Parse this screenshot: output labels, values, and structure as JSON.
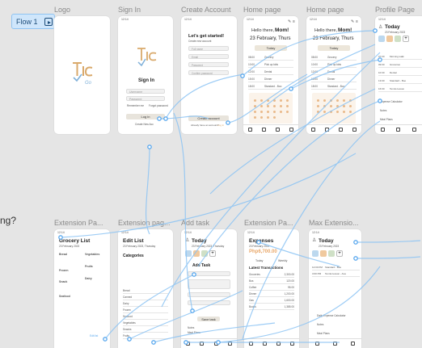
{
  "flow": {
    "label": "Flow 1"
  },
  "side_text": "ng?",
  "frames": {
    "logo": {
      "title": "Logo",
      "brand": "Tic Task",
      "brand_sub": "Go"
    },
    "signin": {
      "title": "Sign In",
      "time": "12:14",
      "heading": "Sign In",
      "brand": "Tic Task",
      "brand_sub": "Go",
      "username_ph": "Username",
      "password_ph": "Password",
      "remember": "Remember me",
      "forgot": "Forgot password",
      "login": "Log in",
      "signup": "Create New Acc"
    },
    "create": {
      "title": "Create Account",
      "time": "12:14",
      "heading": "Let's get started!",
      "sub": "Create new account",
      "field1": "Full name",
      "field2": "Email",
      "field3": "Password",
      "field4": "Confirm password",
      "button": "Create account",
      "footer": "Already have an account?",
      "footer_link": "Log in"
    },
    "home1": {
      "title": "Home page",
      "time": "12:14",
      "greet": "Hello there,",
      "name": "Mom!",
      "date": "23 February, Thurs",
      "today": "Today",
      "rows": [
        "Grocery",
        "Pick up kids",
        "Dental",
        "Dinner",
        "Standard - Boo"
      ],
      "times": [
        "08:00",
        "10:00",
        "12:00",
        "15:00",
        "18:00"
      ]
    },
    "home2": {
      "title": "Home page",
      "time": "12:14",
      "greet": "Hello there,",
      "name": "Mom!",
      "date": "23 February, Thurs",
      "today": "Today",
      "rows": [
        "Grocery",
        "Pick up kids",
        "Dental",
        "Dinner",
        "Standard - Boo"
      ],
      "times": [
        "08:00",
        "10:00",
        "12:00",
        "15:00",
        "18:00"
      ]
    },
    "profile": {
      "title": "Profile Page",
      "time": "12:14",
      "heading": "Today",
      "date": "23 February 2023",
      "rows": [
        "Morning walk",
        "Groceries",
        "Dental",
        "Standard - Boo",
        "Tennis lesson"
      ],
      "times": [
        "07:00",
        "09:00",
        "10:30",
        "13:00",
        "16:00"
      ],
      "links": [
        "Expense Calculator",
        "Notes",
        "Meal Plans"
      ]
    },
    "ext1": {
      "title": "Extension Pa...",
      "time": "12:14",
      "heading": "Grocery List",
      "date": "23 February 2023",
      "sections": [
        "Bread",
        "Frozen",
        "Snack",
        "Seafood"
      ],
      "sections2": [
        "Vegetables",
        "Fruits",
        "Dairy"
      ],
      "done": "Edit list"
    },
    "ext2": {
      "title": "Extension pag...",
      "time": "12:14",
      "heading": "Edit List",
      "date": "23 February 2023, Thursday",
      "categories": "Categories",
      "items": [
        "Bread",
        "Canned",
        "Dairy",
        "Frozen",
        "Seafood",
        "Vegetables",
        "Snacks",
        "Fruits"
      ]
    },
    "addtask": {
      "title": "Add task",
      "time": "12:14",
      "heading": "Today",
      "date": "23 February 2023, Thursday",
      "sub": "Add Task",
      "save": "Save task",
      "links": [
        "Notes",
        "Meal Plans"
      ]
    },
    "ext3": {
      "title": "Extension Pa...",
      "time": "12:14",
      "heading": "Expenses",
      "date": "23 February 2023",
      "amount": "Php6,700.00",
      "tabs": [
        "Today",
        "Weekly"
      ],
      "latest": "Latest Transactions",
      "rows": [
        "Groceries",
        "Bus",
        "Coffee",
        "Dinner",
        "Gas",
        "Books"
      ],
      "values": [
        "2,300.00",
        "120.00",
        "95.00",
        "1,200.00",
        "1,600.00",
        "1,385.00"
      ]
    },
    "maxext": {
      "title": "Max Extensio...",
      "time": "12:14",
      "heading": "Today",
      "date": "23 February 2023",
      "rows": [
        "Standard - Boo",
        "Tennis lesson - Ava"
      ],
      "times": [
        "12:00 PM",
        "3:00 PM"
      ],
      "links": [
        "Daily Expense Calculator",
        "Notes",
        "Meal Plans"
      ]
    }
  },
  "colors": {
    "accent": "#e9a86a",
    "link": "#59a8ee",
    "brand": "#d9a96b",
    "brand2": "#7fb0d9"
  }
}
